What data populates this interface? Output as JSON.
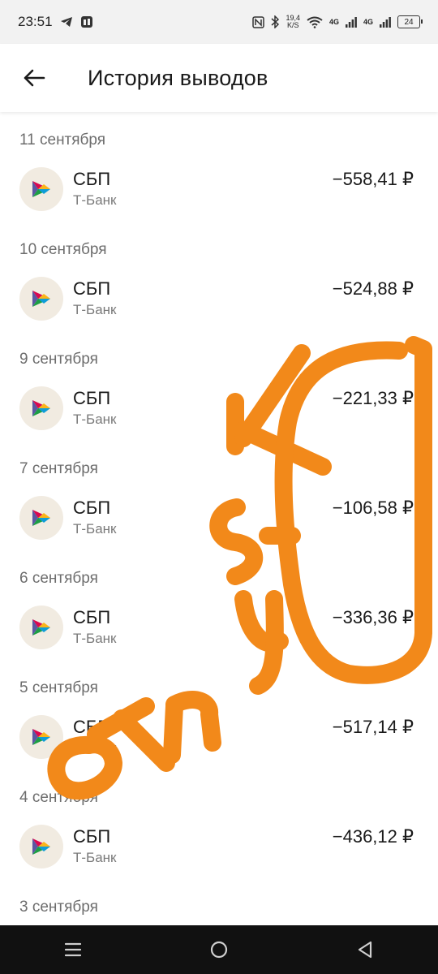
{
  "status_bar": {
    "time": "23:51",
    "speed_value": "19,4",
    "speed_unit": "K/S",
    "network_1": "4G",
    "network_2": "4G",
    "battery": "24"
  },
  "header": {
    "title": "История выводов"
  },
  "groups": [
    {
      "date": "11 сентября",
      "method": "СБП",
      "bank": "Т-Банк",
      "amount": "−558,41 ₽"
    },
    {
      "date": "10 сентября",
      "method": "СБП",
      "bank": "Т-Банк",
      "amount": "−524,88 ₽"
    },
    {
      "date": "9 сентября",
      "method": "СБП",
      "bank": "Т-Банк",
      "amount": "−221,33 ₽"
    },
    {
      "date": "7 сентября",
      "method": "СБП",
      "bank": "Т-Банк",
      "amount": "−106,58 ₽"
    },
    {
      "date": "6 сентября",
      "method": "СБП",
      "bank": "Т-Банк",
      "amount": "−336,36 ₽"
    },
    {
      "date": "5 сентября",
      "method": "СБП",
      "bank": "Т-Банк",
      "amount": "−517,14 ₽"
    },
    {
      "date": "4 сентября",
      "method": "СБП",
      "bank": "Т-Банк",
      "amount": "−436,12 ₽"
    },
    {
      "date": "3 сентября"
    }
  ],
  "colors": {
    "scribble": "#f2891a",
    "logo_bg": "#f1ebe1"
  },
  "icons": [
    "telegram-icon",
    "app-icon",
    "nfc-icon",
    "bluetooth-icon",
    "wifi-icon",
    "signal-icon",
    "battery-icon",
    "back-arrow-icon",
    "sbp-logo-icon",
    "menu-icon",
    "home-icon",
    "back-triangle-icon"
  ]
}
